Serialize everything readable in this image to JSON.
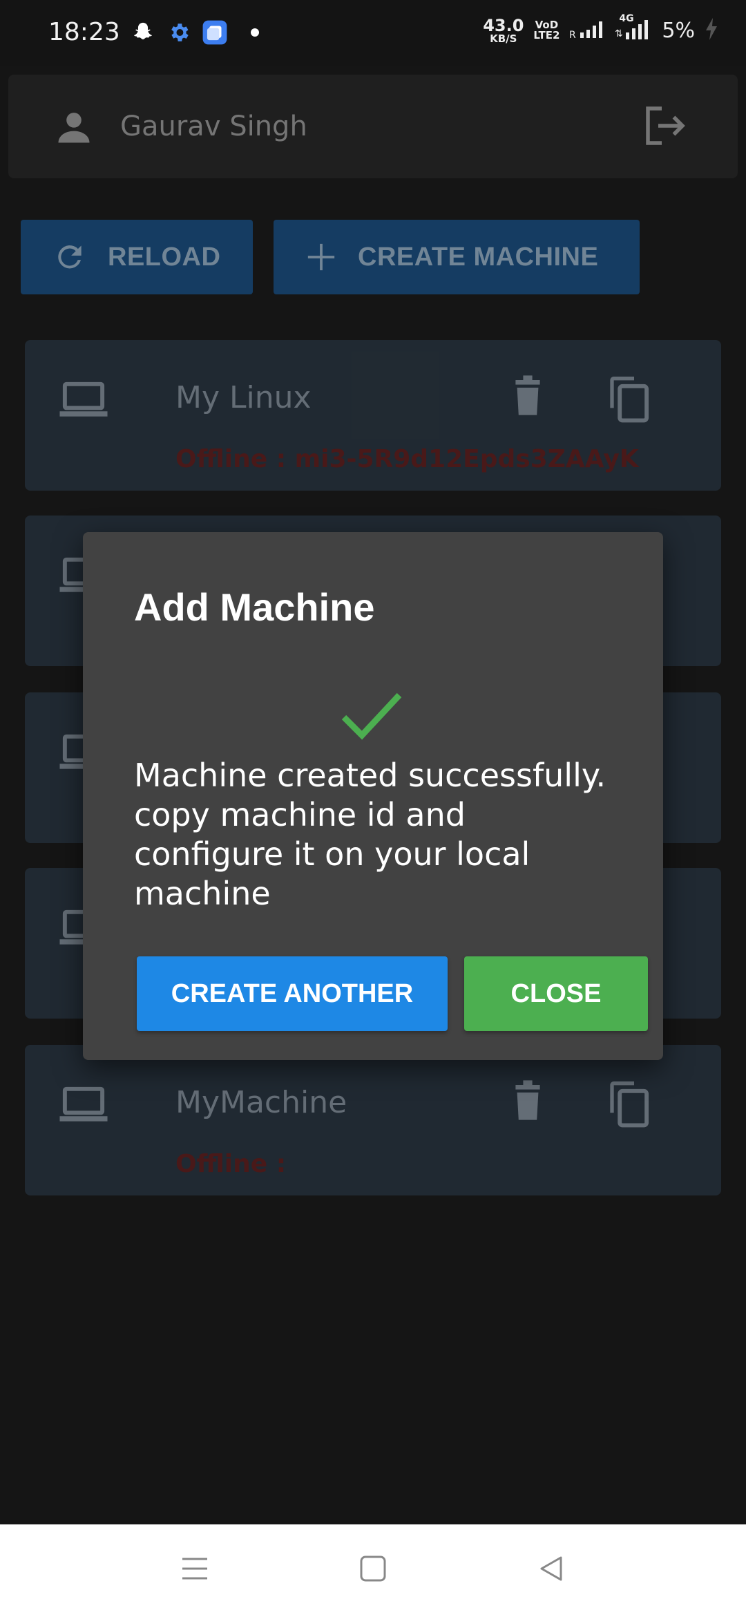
{
  "status_bar": {
    "time": "18:23",
    "net_speed": "43.0",
    "net_unit": "KB/S",
    "volte_top": "VoD",
    "volte_bottom": "LTE2",
    "network": "4G",
    "battery": "5%"
  },
  "header": {
    "user_name": "Gaurav Singh"
  },
  "toolbar": {
    "reload_label": "RELOAD",
    "create_label": "CREATE MACHINE"
  },
  "machines": [
    {
      "name": "My Linux",
      "status": "Offline : mi3-5R9d12Epds3ZAAyK"
    },
    {
      "name": "",
      "status": ""
    },
    {
      "name": "",
      "status": ""
    },
    {
      "name": "",
      "status": ""
    },
    {
      "name": "MyMachine",
      "status": "Offline :"
    }
  ],
  "dialog": {
    "title": "Add Machine",
    "message": "Machine created successfully. copy machine id and configure it on your local machine",
    "create_another_label": "CREATE ANOTHER",
    "close_label": "CLOSE"
  },
  "colors": {
    "primary_button": "#1e88e5",
    "success_button": "#4caf50",
    "check": "#4caf50",
    "card_bg": "#28333d",
    "offline_text": "#5a1f1f"
  }
}
